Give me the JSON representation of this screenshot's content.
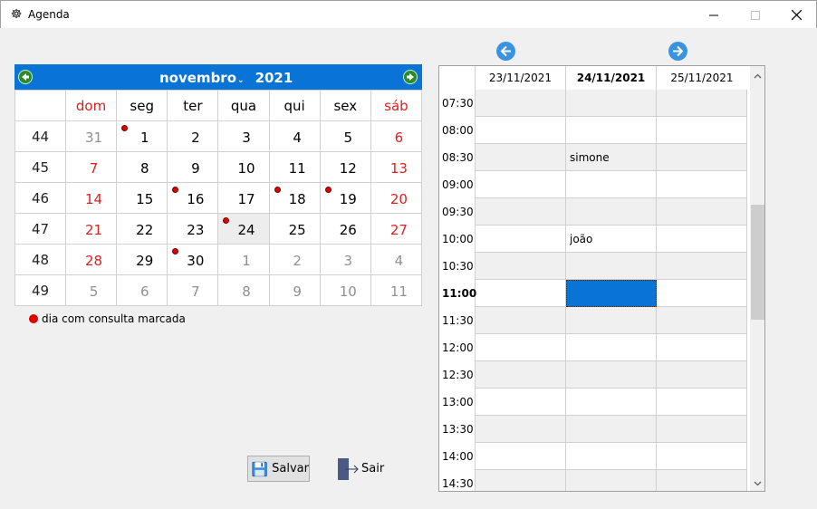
{
  "window": {
    "title": "Agenda",
    "icon": "ear-icon"
  },
  "calendar": {
    "month": "novembro",
    "year": "2021",
    "days_of_week": [
      "dom",
      "seg",
      "ter",
      "qua",
      "qui",
      "sex",
      "sáb"
    ],
    "weeks": [
      {
        "week": "44",
        "days": [
          "31",
          "1",
          "2",
          "3",
          "4",
          "5",
          "6"
        ]
      },
      {
        "week": "45",
        "days": [
          "7",
          "8",
          "9",
          "10",
          "11",
          "12",
          "13"
        ]
      },
      {
        "week": "46",
        "days": [
          "14",
          "15",
          "16",
          "17",
          "18",
          "19",
          "20"
        ]
      },
      {
        "week": "47",
        "days": [
          "21",
          "22",
          "23",
          "24",
          "25",
          "26",
          "27"
        ]
      },
      {
        "week": "48",
        "days": [
          "28",
          "29",
          "30",
          "1",
          "2",
          "3",
          "4"
        ]
      },
      {
        "week": "49",
        "days": [
          "5",
          "6",
          "7",
          "8",
          "9",
          "10",
          "11"
        ]
      }
    ],
    "days_with_appointments": [
      "1",
      "16",
      "18",
      "19",
      "24",
      "30"
    ],
    "today": "24",
    "legend": "dia com consulta marcada",
    "colors": {
      "header": "#0a74d6",
      "weekend": "#e02020",
      "appointment_dot": "#e00000"
    }
  },
  "buttons": {
    "save": "Salvar",
    "exit": "Sair"
  },
  "schedule": {
    "dates": [
      "23/11/2021",
      "24/11/2021",
      "25/11/2021"
    ],
    "selected_date": "24/11/2021",
    "rows": [
      {
        "time": "07:30",
        "cells": [
          "",
          "",
          ""
        ]
      },
      {
        "time": "08:00",
        "cells": [
          "",
          "",
          ""
        ]
      },
      {
        "time": "08:30",
        "cells": [
          "",
          "simone",
          ""
        ]
      },
      {
        "time": "09:00",
        "cells": [
          "",
          "",
          ""
        ]
      },
      {
        "time": "09:30",
        "cells": [
          "",
          "",
          ""
        ]
      },
      {
        "time": "10:00",
        "cells": [
          "",
          "joão",
          ""
        ]
      },
      {
        "time": "10:30",
        "cells": [
          "",
          "",
          ""
        ]
      },
      {
        "time": "11:00",
        "cells": [
          "",
          "",
          ""
        ]
      },
      {
        "time": "11:30",
        "cells": [
          "",
          "",
          ""
        ]
      },
      {
        "time": "12:00",
        "cells": [
          "",
          "",
          ""
        ]
      },
      {
        "time": "12:30",
        "cells": [
          "",
          "",
          ""
        ]
      },
      {
        "time": "13:00",
        "cells": [
          "",
          "",
          ""
        ]
      },
      {
        "time": "13:30",
        "cells": [
          "",
          "",
          ""
        ]
      },
      {
        "time": "14:00",
        "cells": [
          "",
          "",
          ""
        ]
      },
      {
        "time": "14:30",
        "cells": [
          "",
          "",
          ""
        ]
      }
    ],
    "selected_time": "11:00",
    "selected_color": "#0a74d6"
  }
}
